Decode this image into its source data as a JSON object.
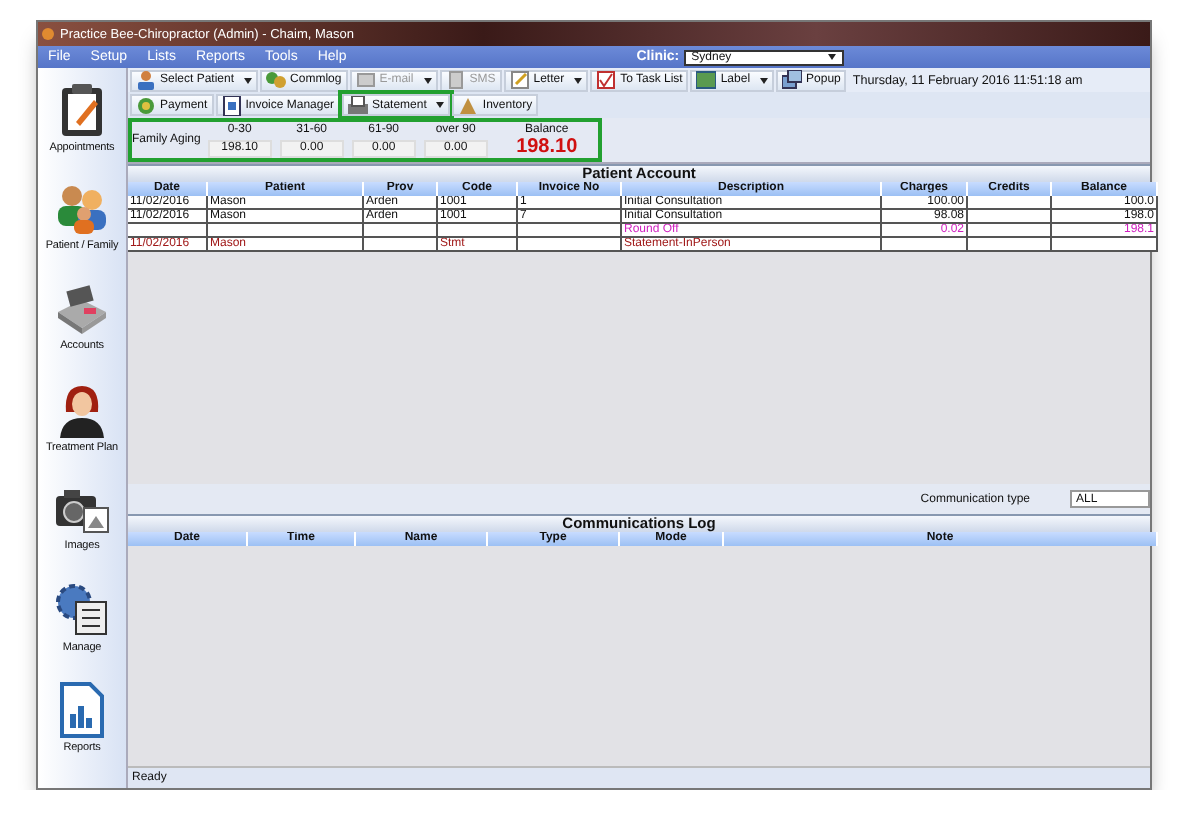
{
  "window": {
    "title": "Practice Bee-Chiropractor (Admin) - Chaim, Mason"
  },
  "menu": [
    "File",
    "Setup",
    "Lists",
    "Reports",
    "Tools",
    "Help"
  ],
  "clinic": {
    "label": "Clinic:",
    "value": "Sydney"
  },
  "toolbar": [
    {
      "label": "Select Patient",
      "dropdown": true,
      "disabled": false
    },
    {
      "label": "Commlog",
      "dropdown": false,
      "disabled": false
    },
    {
      "label": "E-mail",
      "dropdown": true,
      "disabled": true
    },
    {
      "label": "SMS",
      "dropdown": false,
      "disabled": true
    },
    {
      "label": "Letter",
      "dropdown": true,
      "disabled": false
    },
    {
      "label": "To Task List",
      "dropdown": false,
      "disabled": false
    },
    {
      "label": "Label",
      "dropdown": true,
      "disabled": false
    },
    {
      "label": "Popup",
      "dropdown": false,
      "disabled": false
    }
  ],
  "datetime": "Thursday, 11 February 2016 11:51:18 am",
  "toolbar_2": [
    {
      "label": "Payment",
      "dropdown": false,
      "highlighted": false
    },
    {
      "label": "Invoice Manager",
      "dropdown": false,
      "highlighted": false
    },
    {
      "label": "Statement",
      "dropdown": true,
      "highlighted": true
    },
    {
      "label": "Inventory",
      "dropdown": false,
      "highlighted": false
    }
  ],
  "family_aging": {
    "label": "Family Aging",
    "highlighted": true,
    "buckets": [
      {
        "heading": "0-30",
        "value": "198.10"
      },
      {
        "heading": "31-60",
        "value": "0.00"
      },
      {
        "heading": "61-90",
        "value": "0.00"
      },
      {
        "heading": "over 90",
        "value": "0.00"
      }
    ],
    "balance_label": "Balance",
    "balance": "198.10"
  },
  "sidebar": {
    "items": [
      {
        "label": "Appointments"
      },
      {
        "label": "Patient / Family"
      },
      {
        "label": "Accounts"
      },
      {
        "label": "Treatment Plan"
      },
      {
        "label": "Images"
      },
      {
        "label": "Manage"
      },
      {
        "label": "Reports"
      }
    ]
  },
  "patient_account": {
    "title": "Patient Account",
    "columns": [
      "Date",
      "Patient",
      "Prov",
      "Code",
      "Invoice No",
      "Description",
      "Charges",
      "Credits",
      "Balance"
    ],
    "rows": [
      {
        "kind": "charge",
        "cells": [
          "11/02/2016",
          "Mason",
          "Arden",
          "1001",
          "1",
          "Initial Consultation",
          "100.00",
          null,
          "100.0"
        ]
      },
      {
        "kind": "charge",
        "cells": [
          "11/02/2016",
          "Mason",
          "Arden",
          "1001",
          "7",
          "Initial Consultation",
          "98.08",
          null,
          "198.0"
        ]
      },
      {
        "kind": "adjustment",
        "cells": [
          null,
          null,
          null,
          null,
          null,
          "Round Off",
          "0.02",
          null,
          "198.1"
        ]
      },
      {
        "kind": "statement",
        "cells": [
          "11/02/2016",
          "Mason",
          null,
          "Stmt",
          null,
          "Statement-InPerson",
          null,
          null,
          null
        ]
      }
    ]
  },
  "communications": {
    "type_label": "Communication type",
    "type_value": "ALL",
    "title": "Communications Log",
    "columns": [
      "Date",
      "Time",
      "Name",
      "Type",
      "Mode",
      "Note"
    ]
  },
  "status_bar": "Ready"
}
